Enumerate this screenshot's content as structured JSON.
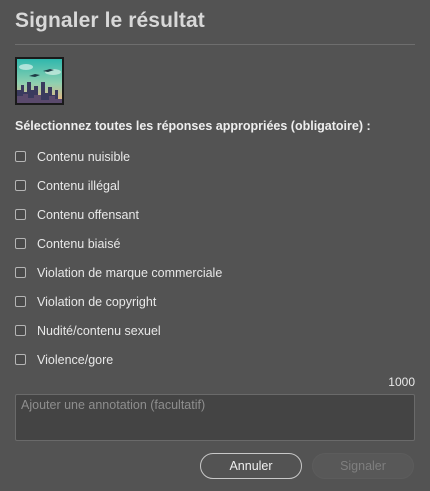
{
  "dialog": {
    "title": "Signaler le résultat"
  },
  "thumbnail": {
    "icon": "generated-image-thumbnail",
    "colors": {
      "sky_top": "#37c2b4",
      "sky_bottom": "#f0b57a",
      "city": "#3b3a5c",
      "frame": "#1a1a1a"
    }
  },
  "prompt": "Sélectionnez toutes les réponses appropriées (obligatoire) :",
  "options": [
    {
      "label": "Contenu nuisible",
      "checked": false
    },
    {
      "label": "Contenu illégal",
      "checked": false
    },
    {
      "label": "Contenu offensant",
      "checked": false
    },
    {
      "label": "Contenu biaisé",
      "checked": false
    },
    {
      "label": "Violation de marque commerciale",
      "checked": false
    },
    {
      "label": "Violation de copyright",
      "checked": false
    },
    {
      "label": "Nudité/contenu sexuel",
      "checked": false
    },
    {
      "label": "Violence/gore",
      "checked": false
    }
  ],
  "annotation": {
    "char_limit": "1000",
    "placeholder": "Ajouter une annotation (facultatif)",
    "value": ""
  },
  "buttons": {
    "cancel": "Annuler",
    "submit": "Signaler",
    "submit_disabled": true
  },
  "colors": {
    "background": "#535353",
    "text": "#e6e6e6",
    "disabled_text": "#7f7f7f"
  }
}
